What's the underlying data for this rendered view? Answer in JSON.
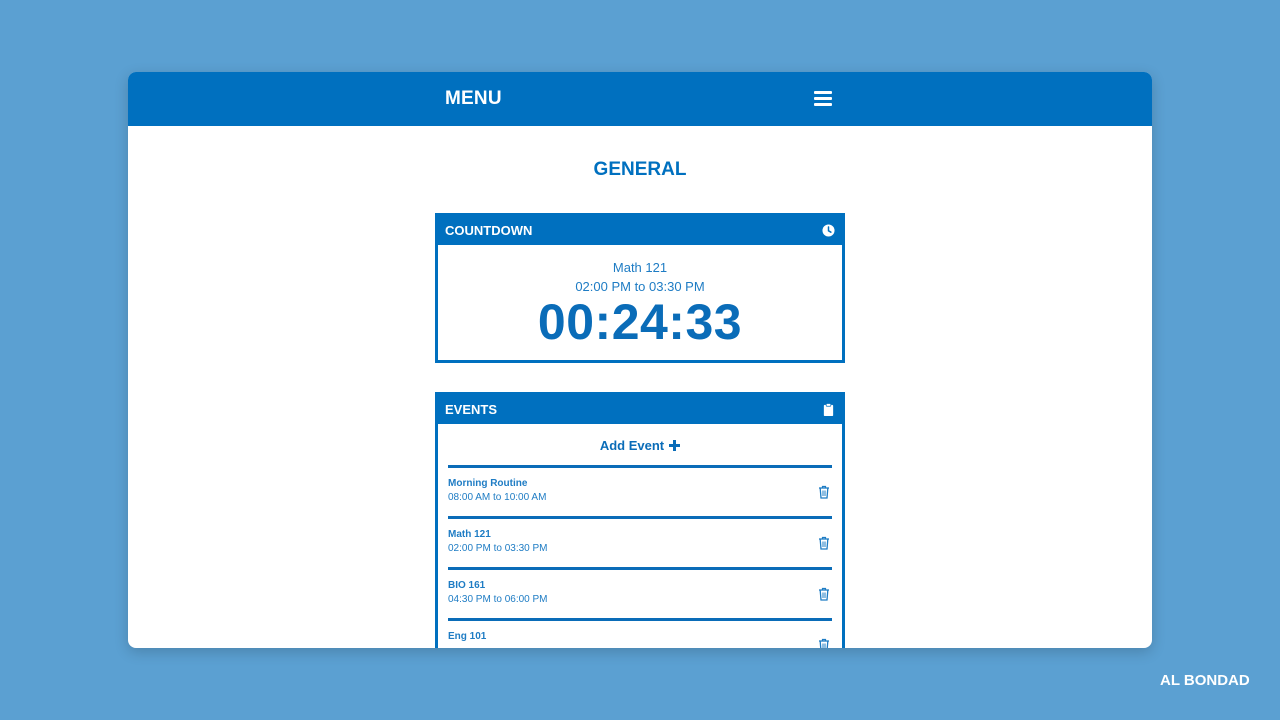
{
  "header": {
    "menu_label": "MENU",
    "menu_icon": "hamburger-icon"
  },
  "page": {
    "title": "GENERAL"
  },
  "countdown": {
    "title": "COUNTDOWN",
    "icon": "clock-icon",
    "class_name": "Math 121",
    "time_range": "02:00 PM to 03:30 PM",
    "remaining": "00:24:33"
  },
  "events": {
    "title": "EVENTS",
    "icon": "clipboard-icon",
    "add_label": "Add Event",
    "items": [
      {
        "name": "Morning Routine",
        "time": "08:00 AM to 10:00 AM"
      },
      {
        "name": "Math 121",
        "time": "02:00 PM to 03:30 PM"
      },
      {
        "name": "BIO 161",
        "time": "04:30 PM to 06:00 PM"
      },
      {
        "name": "Eng 101",
        "time": ""
      }
    ]
  },
  "colors": {
    "background": "#5ba0d2",
    "accent": "#0070bf",
    "surface": "#ffffff"
  },
  "watermark": "AL BONDAD"
}
